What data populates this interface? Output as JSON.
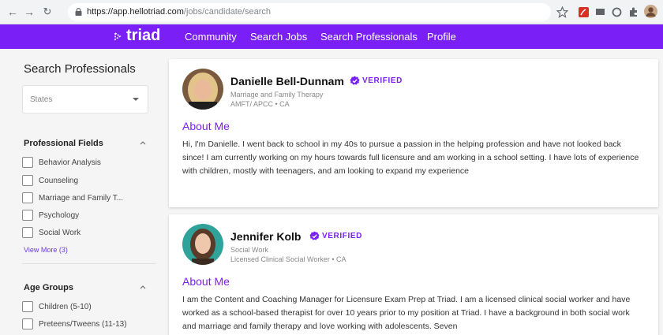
{
  "browser": {
    "url_host": "https://app.hellotriad.com",
    "url_path": "/jobs/candidate/search"
  },
  "nav": {
    "brand": "triad",
    "links": [
      "Community",
      "Search Jobs",
      "Search Professionals",
      "Profile"
    ]
  },
  "sidebar": {
    "title": "Search Professionals",
    "states_placeholder": "States",
    "professional_fields": {
      "heading": "Professional Fields",
      "options": [
        "Behavior Analysis",
        "Counseling",
        "Marriage and Family T...",
        "Psychology",
        "Social Work"
      ],
      "view_more": "View More (3)"
    },
    "age_groups": {
      "heading": "Age Groups",
      "options": [
        "Children (5-10)",
        "Preteens/Tweens (11-13)"
      ]
    }
  },
  "results": [
    {
      "name": "Danielle Bell-Dunnam",
      "verified_label": "VERIFIED",
      "field": "Marriage and Family Therapy",
      "credentials": "AMFT/ APCC • CA",
      "about_heading": "About Me",
      "bio": "Hi, I'm Danielle. I went back to school in my 40s to pursue a passion in the helping profession and have not looked back since! I am currently working on my hours towards full licensure and am working in a school setting. I have lots of experience with children, mostly with teenagers, and am looking to expand my experience"
    },
    {
      "name": "Jennifer Kolb",
      "verified_label": "VERIFIED",
      "field": "Social Work",
      "credentials": "Licensed Clinical Social Worker • CA",
      "about_heading": "About Me",
      "bio": "I am the Content and Coaching Manager for Licensure Exam Prep at Triad. I am a licensed clinical social worker and have worked as a school-based therapist for over 10 years prior to my position at Triad. I have a background in both social work and marriage and family therapy and love working with adolescents. Seven"
    }
  ],
  "colors": {
    "brand": "#7a1ff5",
    "sidebar_bg": "#f5f5f6"
  }
}
